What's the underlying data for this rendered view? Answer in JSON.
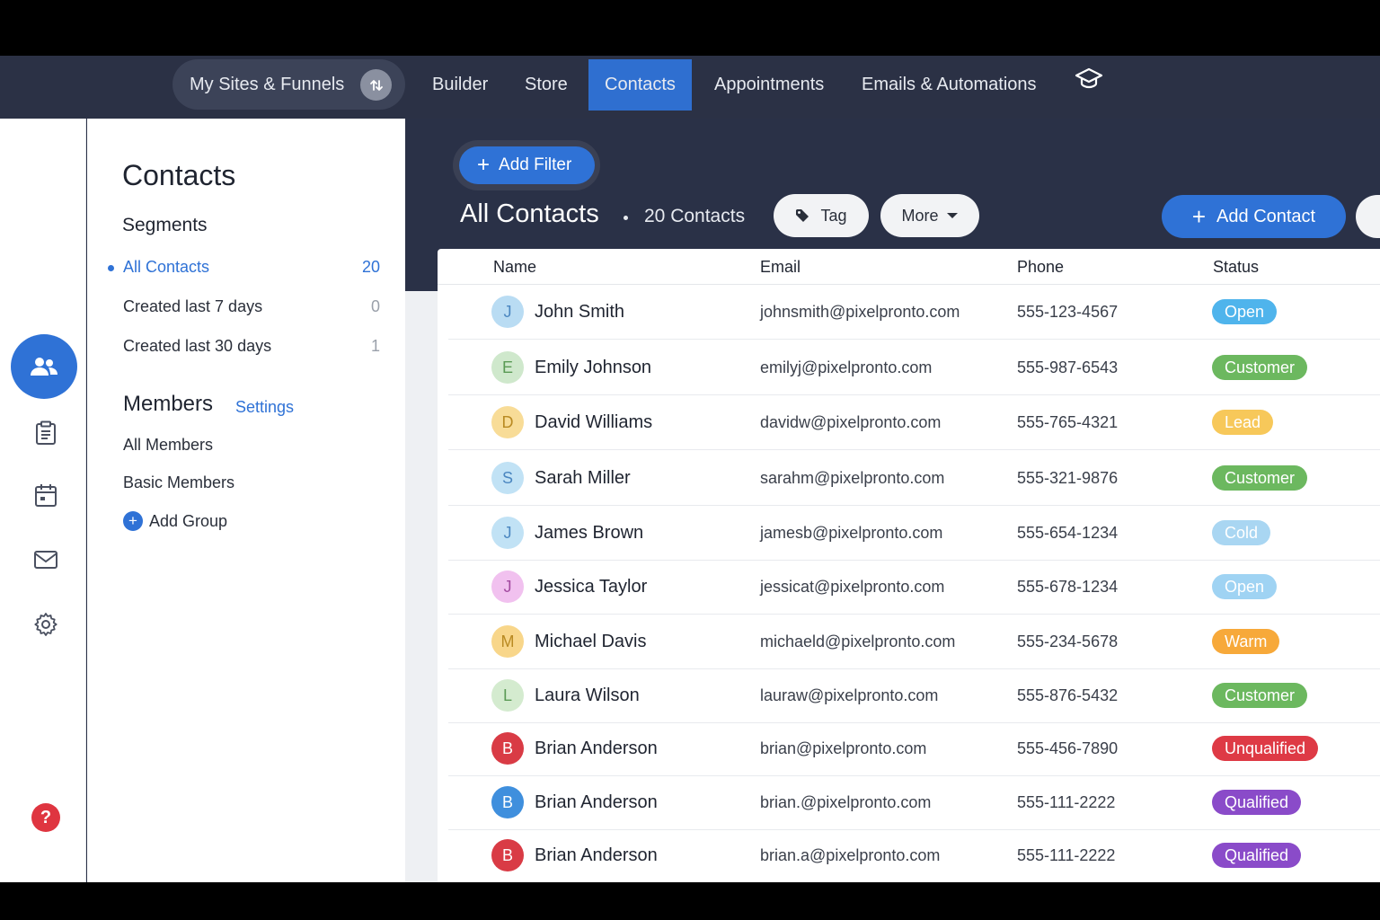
{
  "topnav": {
    "sites_label": "My Sites & Funnels",
    "items": [
      {
        "label": "Builder",
        "active": false
      },
      {
        "label": "Store",
        "active": false
      },
      {
        "label": "Contacts",
        "active": true
      },
      {
        "label": "Appointments",
        "active": false
      },
      {
        "label": "Emails & Automations",
        "active": false
      }
    ],
    "extra_icon": "graduation-cap-icon"
  },
  "rail": {
    "icons": [
      "contacts-icon",
      "clipboard-icon",
      "calendar-icon",
      "mail-icon",
      "gear-icon"
    ],
    "active": "contacts-icon",
    "help_label": "?"
  },
  "panel": {
    "title": "Contacts",
    "segments_heading": "Segments",
    "segments": [
      {
        "label": "All Contacts",
        "count": "20",
        "active": true
      },
      {
        "label": "Created last 7 days",
        "count": "0",
        "active": false
      },
      {
        "label": "Created last 30 days",
        "count": "1",
        "active": false
      }
    ],
    "members_heading": "Members",
    "members_settings": "Settings",
    "members": [
      "All Members",
      "Basic Members"
    ],
    "add_group": "Add Group"
  },
  "main": {
    "add_filter": "Add Filter",
    "title": "All Contacts",
    "count_label": "20 Contacts",
    "tag_button": "Tag",
    "more_button": "More",
    "add_contact": "Add Contact"
  },
  "table": {
    "headers": [
      "Name",
      "Email",
      "Phone",
      "Status"
    ],
    "rows": [
      {
        "initial": "J",
        "name": "John Smith",
        "email": "johnsmith@pixelpronto.com",
        "phone": "555-123-4567",
        "status": "Open",
        "avatar_bg": "#b9dcf3",
        "avatar_fg": "#4a86c0",
        "status_color": "#4fb4ec"
      },
      {
        "initial": "E",
        "name": "Emily Johnson",
        "email": "emilyj@pixelpronto.com",
        "phone": "555-987-6543",
        "status": "Customer",
        "avatar_bg": "#cfe8cc",
        "avatar_fg": "#5a9a55",
        "status_color": "#6cb85f"
      },
      {
        "initial": "D",
        "name": "David Williams",
        "email": "davidw@pixelpronto.com",
        "phone": "555-765-4321",
        "status": "Lead",
        "avatar_bg": "#f8dc97",
        "avatar_fg": "#b98a22",
        "status_color": "#f7c85a"
      },
      {
        "initial": "S",
        "name": "Sarah Miller",
        "email": "sarahm@pixelpronto.com",
        "phone": "555-321-9876",
        "status": "Customer",
        "avatar_bg": "#c1e2f5",
        "avatar_fg": "#4a86c0",
        "status_color": "#6cb85f"
      },
      {
        "initial": "J",
        "name": "James Brown",
        "email": "jamesb@pixelpronto.com",
        "phone": "555-654-1234",
        "status": "Cold",
        "avatar_bg": "#c1e2f5",
        "avatar_fg": "#4a86c0",
        "status_color": "#a9d6f2"
      },
      {
        "initial": "J",
        "name": "Jessica Taylor",
        "email": "jessicat@pixelpronto.com",
        "phone": "555-678-1234",
        "status": "Open",
        "avatar_bg": "#f1c1ef",
        "avatar_fg": "#a34aa0",
        "status_color": "#9fd3f3"
      },
      {
        "initial": "M",
        "name": "Michael Davis",
        "email": "michaeld@pixelpronto.com",
        "phone": "555-234-5678",
        "status": "Warm",
        "avatar_bg": "#f8d68a",
        "avatar_fg": "#b98a22",
        "status_color": "#f7a93a"
      },
      {
        "initial": "L",
        "name": "Laura Wilson",
        "email": "lauraw@pixelpronto.com",
        "phone": "555-876-5432",
        "status": "Customer",
        "avatar_bg": "#d4ebcf",
        "avatar_fg": "#5a9a55",
        "status_color": "#6cb85f"
      },
      {
        "initial": "B",
        "name": "Brian Anderson",
        "email": "brian@pixelpronto.com",
        "phone": "555-456-7890",
        "status": "Unqualified",
        "avatar_bg": "#d93b45",
        "avatar_fg": "#ffffff",
        "status_color": "#de3a45"
      },
      {
        "initial": "B",
        "name": "Brian Anderson",
        "email": "brian.@pixelpronto.com",
        "phone": "555-111-2222",
        "status": "Qualified",
        "avatar_bg": "#3f8fdd",
        "avatar_fg": "#ffffff",
        "status_color": "#8a4bc9"
      },
      {
        "initial": "B",
        "name": "Brian Anderson",
        "email": "brian.a@pixelpronto.com",
        "phone": "555-111-2222",
        "status": "Qualified",
        "avatar_bg": "#d93b45",
        "avatar_fg": "#ffffff",
        "status_color": "#8a4bc9"
      }
    ]
  }
}
